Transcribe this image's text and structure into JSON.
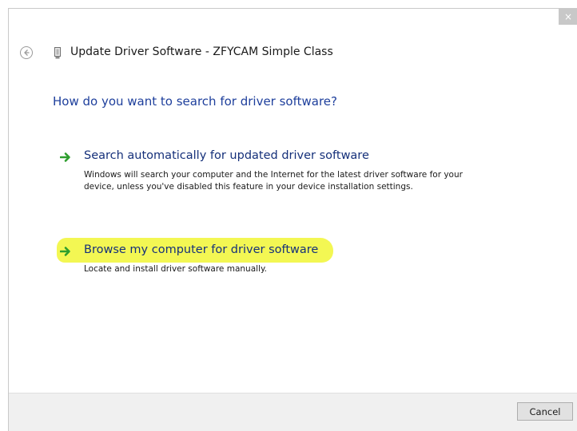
{
  "window": {
    "close_glyph": "×",
    "title": "Update Driver Software - ZFYCAM Simple Class"
  },
  "main": {
    "instruction": "How do you want to search for driver software?",
    "options": [
      {
        "title": "Search automatically for updated driver software",
        "description": "Windows will search your computer and the Internet for the latest driver software for your device, unless you've disabled this feature in your device installation settings.",
        "icon": "green-arrow-icon",
        "highlighted": false
      },
      {
        "title": "Browse my computer for driver software",
        "description": "Locate and install driver software manually.",
        "icon": "green-arrow-icon",
        "highlighted": true
      }
    ]
  },
  "footer": {
    "cancel_label": "Cancel"
  },
  "colors": {
    "instruction": "#1e3f9c",
    "option_title": "#15307a",
    "arrow": "#2e9e2e",
    "highlight": "#f2f74a",
    "footer_bg": "#f0f0f0"
  }
}
